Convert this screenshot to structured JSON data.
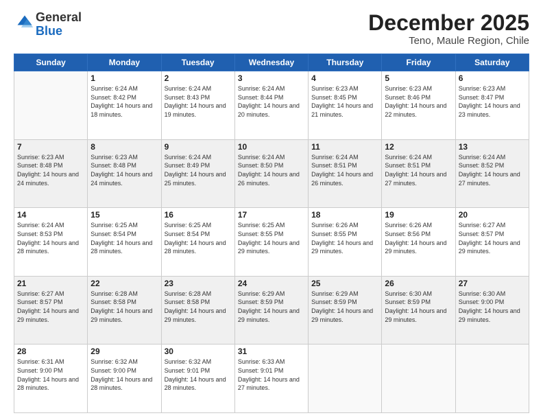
{
  "logo": {
    "general": "General",
    "blue": "Blue"
  },
  "title": "December 2025",
  "subtitle": "Teno, Maule Region, Chile",
  "days_of_week": [
    "Sunday",
    "Monday",
    "Tuesday",
    "Wednesday",
    "Thursday",
    "Friday",
    "Saturday"
  ],
  "weeks": [
    [
      {
        "day": "",
        "sunrise": "",
        "sunset": "",
        "daylight": ""
      },
      {
        "day": "1",
        "sunrise": "Sunrise: 6:24 AM",
        "sunset": "Sunset: 8:42 PM",
        "daylight": "Daylight: 14 hours and 18 minutes."
      },
      {
        "day": "2",
        "sunrise": "Sunrise: 6:24 AM",
        "sunset": "Sunset: 8:43 PM",
        "daylight": "Daylight: 14 hours and 19 minutes."
      },
      {
        "day": "3",
        "sunrise": "Sunrise: 6:24 AM",
        "sunset": "Sunset: 8:44 PM",
        "daylight": "Daylight: 14 hours and 20 minutes."
      },
      {
        "day": "4",
        "sunrise": "Sunrise: 6:23 AM",
        "sunset": "Sunset: 8:45 PM",
        "daylight": "Daylight: 14 hours and 21 minutes."
      },
      {
        "day": "5",
        "sunrise": "Sunrise: 6:23 AM",
        "sunset": "Sunset: 8:46 PM",
        "daylight": "Daylight: 14 hours and 22 minutes."
      },
      {
        "day": "6",
        "sunrise": "Sunrise: 6:23 AM",
        "sunset": "Sunset: 8:47 PM",
        "daylight": "Daylight: 14 hours and 23 minutes."
      }
    ],
    [
      {
        "day": "7",
        "sunrise": "Sunrise: 6:23 AM",
        "sunset": "Sunset: 8:48 PM",
        "daylight": "Daylight: 14 hours and 24 minutes."
      },
      {
        "day": "8",
        "sunrise": "Sunrise: 6:23 AM",
        "sunset": "Sunset: 8:48 PM",
        "daylight": "Daylight: 14 hours and 24 minutes."
      },
      {
        "day": "9",
        "sunrise": "Sunrise: 6:24 AM",
        "sunset": "Sunset: 8:49 PM",
        "daylight": "Daylight: 14 hours and 25 minutes."
      },
      {
        "day": "10",
        "sunrise": "Sunrise: 6:24 AM",
        "sunset": "Sunset: 8:50 PM",
        "daylight": "Daylight: 14 hours and 26 minutes."
      },
      {
        "day": "11",
        "sunrise": "Sunrise: 6:24 AM",
        "sunset": "Sunset: 8:51 PM",
        "daylight": "Daylight: 14 hours and 26 minutes."
      },
      {
        "day": "12",
        "sunrise": "Sunrise: 6:24 AM",
        "sunset": "Sunset: 8:51 PM",
        "daylight": "Daylight: 14 hours and 27 minutes."
      },
      {
        "day": "13",
        "sunrise": "Sunrise: 6:24 AM",
        "sunset": "Sunset: 8:52 PM",
        "daylight": "Daylight: 14 hours and 27 minutes."
      }
    ],
    [
      {
        "day": "14",
        "sunrise": "Sunrise: 6:24 AM",
        "sunset": "Sunset: 8:53 PM",
        "daylight": "Daylight: 14 hours and 28 minutes."
      },
      {
        "day": "15",
        "sunrise": "Sunrise: 6:25 AM",
        "sunset": "Sunset: 8:54 PM",
        "daylight": "Daylight: 14 hours and 28 minutes."
      },
      {
        "day": "16",
        "sunrise": "Sunrise: 6:25 AM",
        "sunset": "Sunset: 8:54 PM",
        "daylight": "Daylight: 14 hours and 28 minutes."
      },
      {
        "day": "17",
        "sunrise": "Sunrise: 6:25 AM",
        "sunset": "Sunset: 8:55 PM",
        "daylight": "Daylight: 14 hours and 29 minutes."
      },
      {
        "day": "18",
        "sunrise": "Sunrise: 6:26 AM",
        "sunset": "Sunset: 8:55 PM",
        "daylight": "Daylight: 14 hours and 29 minutes."
      },
      {
        "day": "19",
        "sunrise": "Sunrise: 6:26 AM",
        "sunset": "Sunset: 8:56 PM",
        "daylight": "Daylight: 14 hours and 29 minutes."
      },
      {
        "day": "20",
        "sunrise": "Sunrise: 6:27 AM",
        "sunset": "Sunset: 8:57 PM",
        "daylight": "Daylight: 14 hours and 29 minutes."
      }
    ],
    [
      {
        "day": "21",
        "sunrise": "Sunrise: 6:27 AM",
        "sunset": "Sunset: 8:57 PM",
        "daylight": "Daylight: 14 hours and 29 minutes."
      },
      {
        "day": "22",
        "sunrise": "Sunrise: 6:28 AM",
        "sunset": "Sunset: 8:58 PM",
        "daylight": "Daylight: 14 hours and 29 minutes."
      },
      {
        "day": "23",
        "sunrise": "Sunrise: 6:28 AM",
        "sunset": "Sunset: 8:58 PM",
        "daylight": "Daylight: 14 hours and 29 minutes."
      },
      {
        "day": "24",
        "sunrise": "Sunrise: 6:29 AM",
        "sunset": "Sunset: 8:59 PM",
        "daylight": "Daylight: 14 hours and 29 minutes."
      },
      {
        "day": "25",
        "sunrise": "Sunrise: 6:29 AM",
        "sunset": "Sunset: 8:59 PM",
        "daylight": "Daylight: 14 hours and 29 minutes."
      },
      {
        "day": "26",
        "sunrise": "Sunrise: 6:30 AM",
        "sunset": "Sunset: 8:59 PM",
        "daylight": "Daylight: 14 hours and 29 minutes."
      },
      {
        "day": "27",
        "sunrise": "Sunrise: 6:30 AM",
        "sunset": "Sunset: 9:00 PM",
        "daylight": "Daylight: 14 hours and 29 minutes."
      }
    ],
    [
      {
        "day": "28",
        "sunrise": "Sunrise: 6:31 AM",
        "sunset": "Sunset: 9:00 PM",
        "daylight": "Daylight: 14 hours and 28 minutes."
      },
      {
        "day": "29",
        "sunrise": "Sunrise: 6:32 AM",
        "sunset": "Sunset: 9:00 PM",
        "daylight": "Daylight: 14 hours and 28 minutes."
      },
      {
        "day": "30",
        "sunrise": "Sunrise: 6:32 AM",
        "sunset": "Sunset: 9:01 PM",
        "daylight": "Daylight: 14 hours and 28 minutes."
      },
      {
        "day": "31",
        "sunrise": "Sunrise: 6:33 AM",
        "sunset": "Sunset: 9:01 PM",
        "daylight": "Daylight: 14 hours and 27 minutes."
      },
      {
        "day": "",
        "sunrise": "",
        "sunset": "",
        "daylight": ""
      },
      {
        "day": "",
        "sunrise": "",
        "sunset": "",
        "daylight": ""
      },
      {
        "day": "",
        "sunrise": "",
        "sunset": "",
        "daylight": ""
      }
    ]
  ]
}
